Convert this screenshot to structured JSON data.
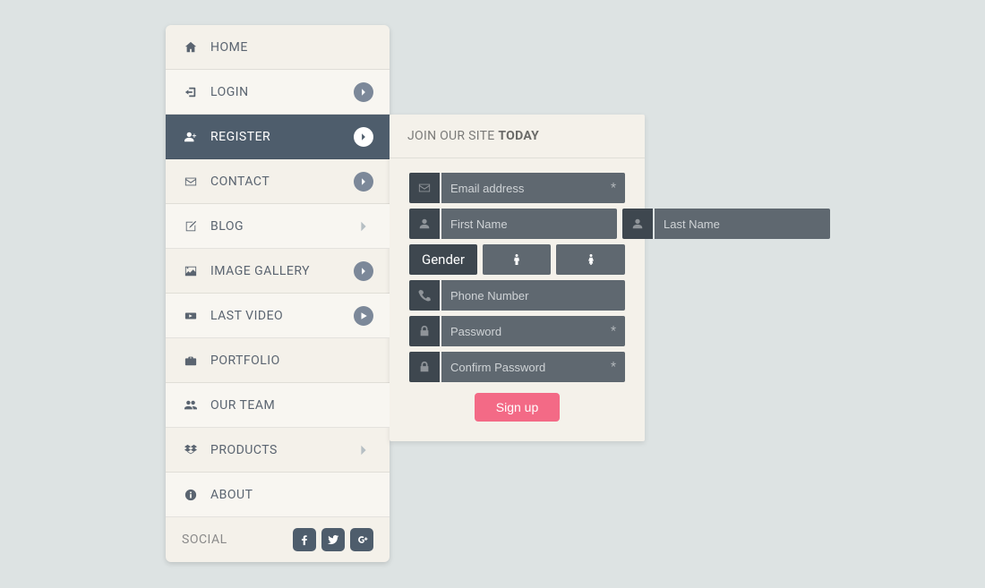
{
  "sidebar": {
    "items": [
      {
        "label": "HOME",
        "icon": "home",
        "indicator": "none",
        "active": false
      },
      {
        "label": "LOGIN",
        "icon": "signin",
        "indicator": "circle"
      },
      {
        "label": "REGISTER",
        "icon": "useradd",
        "indicator": "circle",
        "active": true
      },
      {
        "label": "CONTACT",
        "icon": "mail",
        "indicator": "circle"
      },
      {
        "label": "BLOG",
        "icon": "edit",
        "indicator": "plain"
      },
      {
        "label": "IMAGE GALLERY",
        "icon": "image",
        "indicator": "circle"
      },
      {
        "label": "LAST VIDEO",
        "icon": "video",
        "indicator": "play"
      },
      {
        "label": "PORTFOLIO",
        "icon": "briefcase",
        "indicator": "none"
      },
      {
        "label": "OUR TEAM",
        "icon": "users",
        "indicator": "none"
      },
      {
        "label": "PRODUCTS",
        "icon": "dropbox",
        "indicator": "plain"
      },
      {
        "label": "ABOUT",
        "icon": "info",
        "indicator": "none"
      }
    ],
    "social_label": "SOCIAL"
  },
  "panel": {
    "title_prefix": "JOIN OUR SITE ",
    "title_bold": "TODAY",
    "fields": {
      "email": {
        "placeholder": "Email address"
      },
      "first_name": {
        "placeholder": "First Name"
      },
      "last_name": {
        "placeholder": "Last Name"
      },
      "gender_label": "Gender",
      "phone": {
        "placeholder": "Phone Number"
      },
      "password": {
        "placeholder": "Password"
      },
      "confirm": {
        "placeholder": "Confirm Password"
      }
    },
    "signup_label": "Sign up"
  },
  "colors": {
    "bg": "#dde3e3",
    "sidebar_bg": "#f4f1ea",
    "active_bg": "#4e5d6c",
    "input_bg": "#5f6870",
    "addon_bg": "#3e474f",
    "accent": "#f36a86"
  }
}
